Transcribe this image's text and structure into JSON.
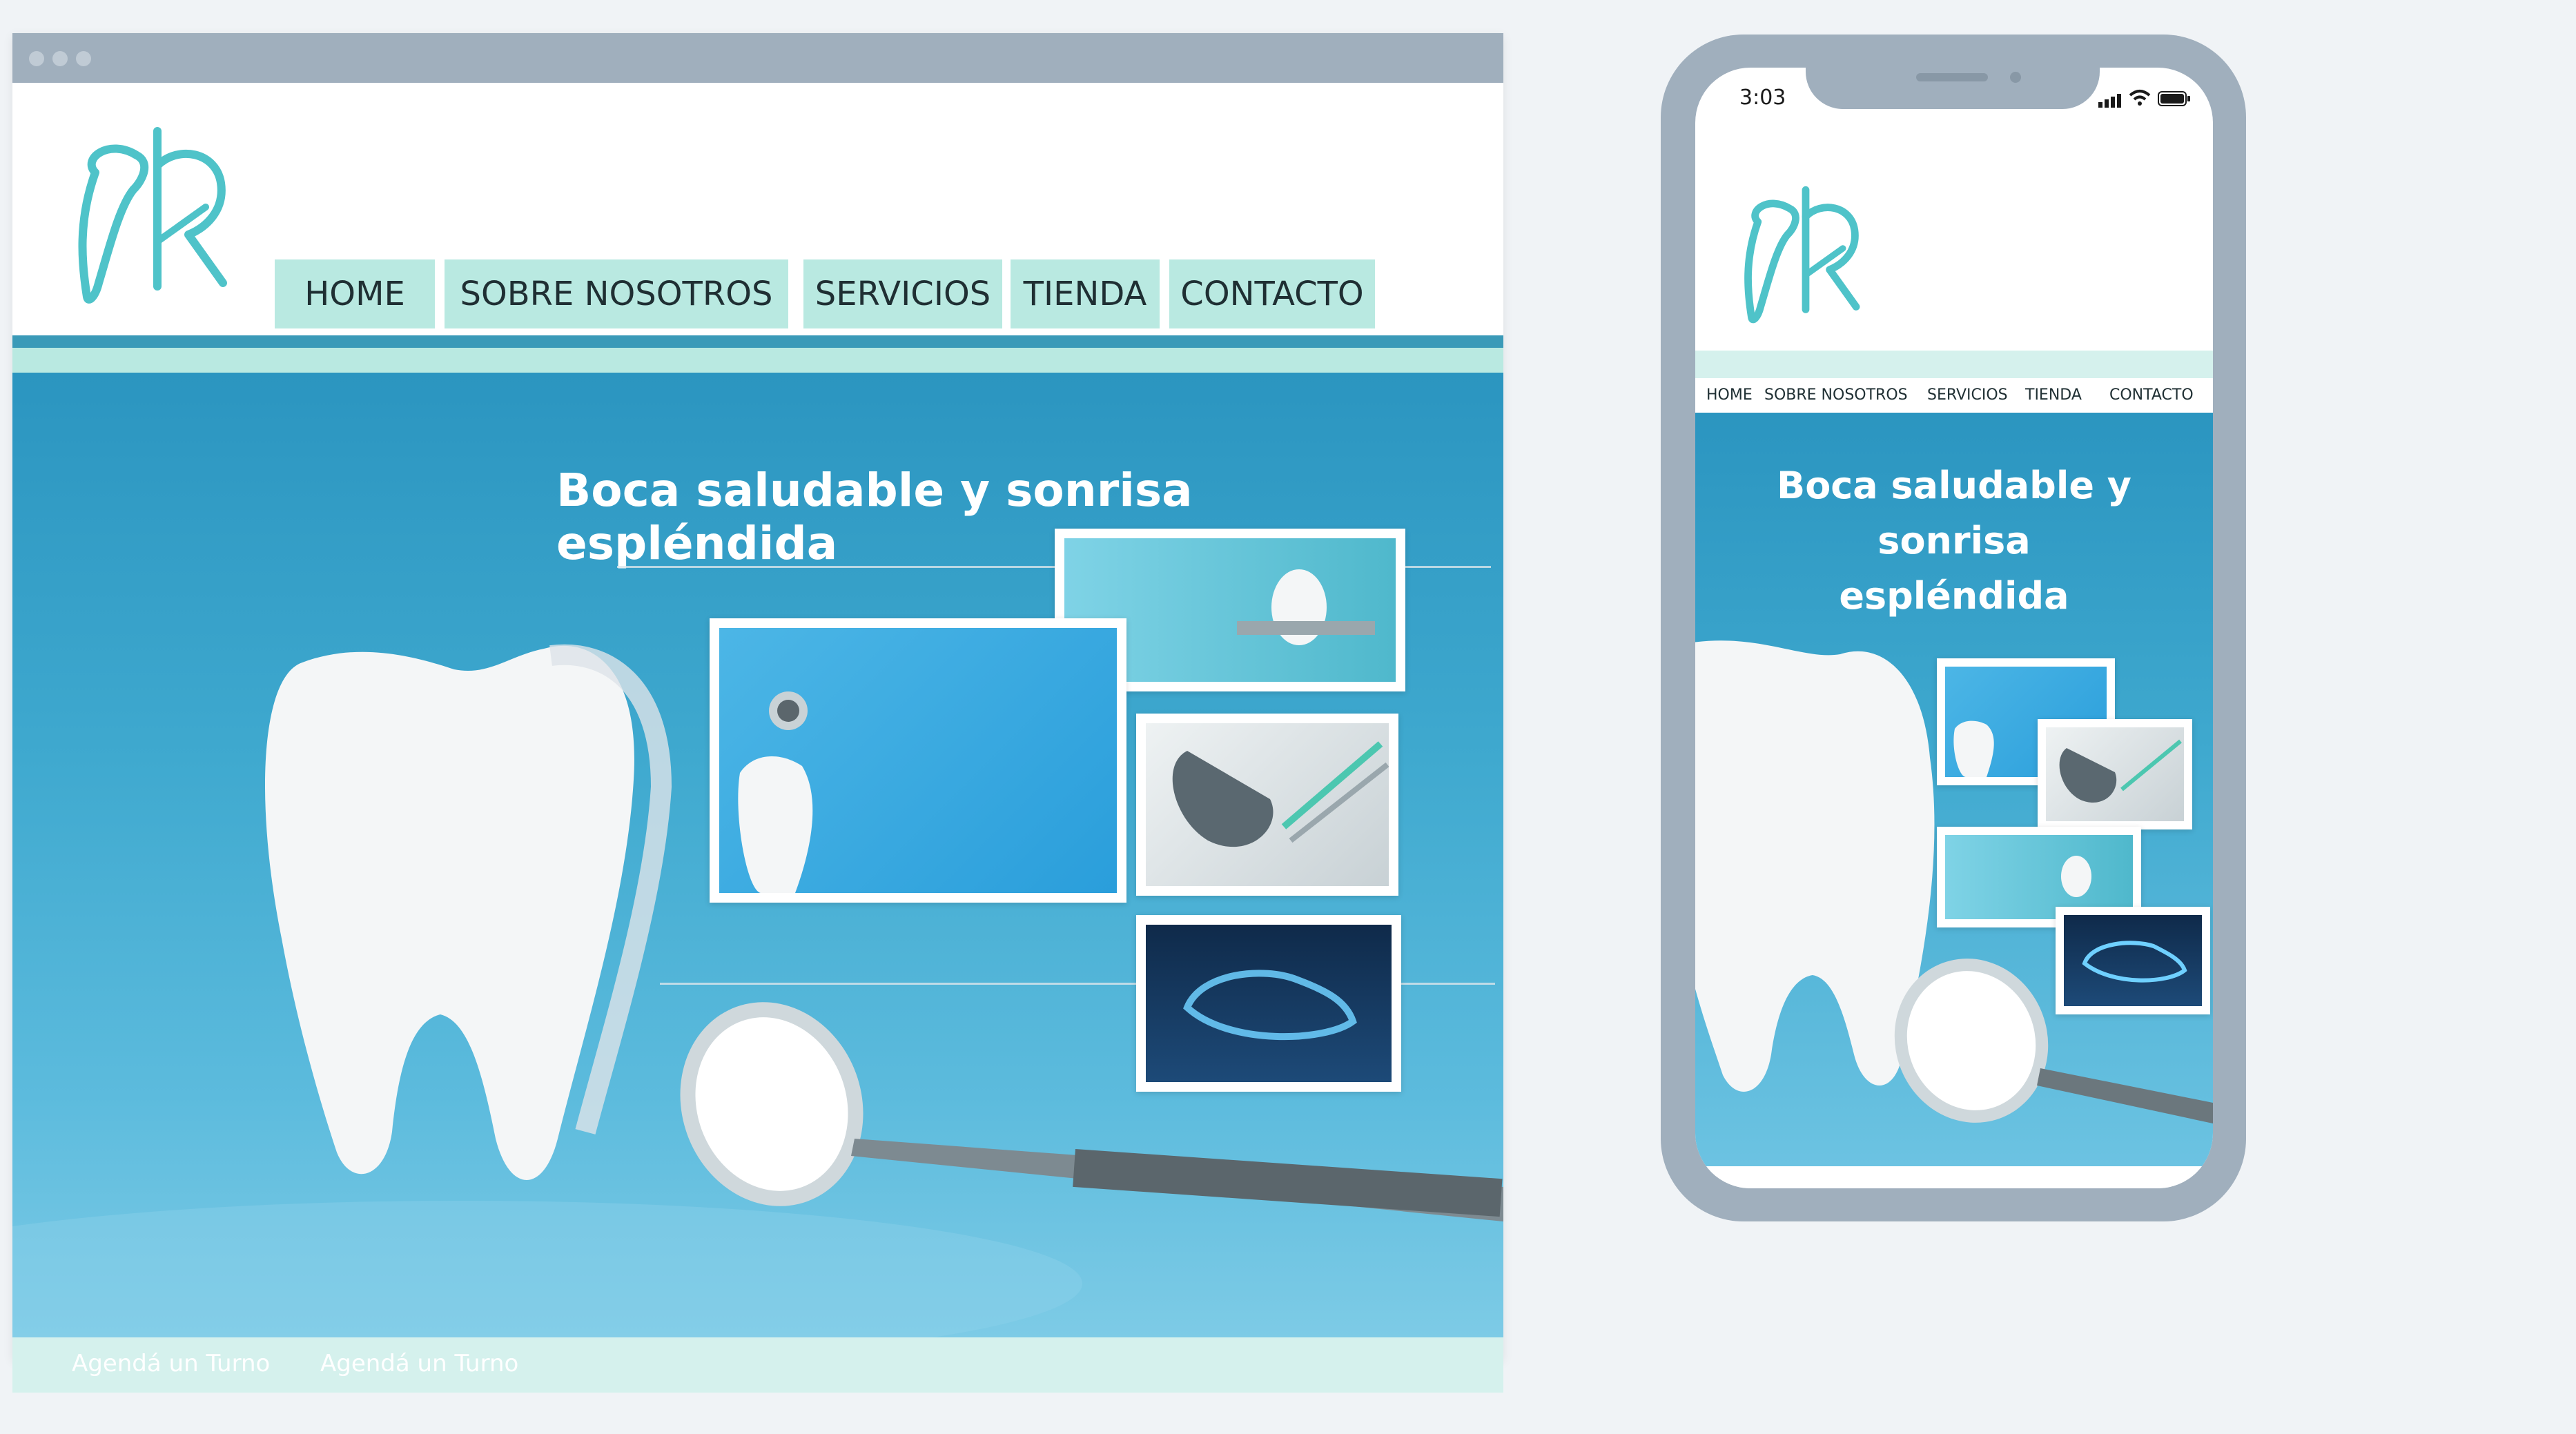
{
  "desktop": {
    "nav": [
      "HOME",
      "SOBRE NOSOTROS",
      "SERVICIOS",
      "TIENDA",
      "CONTACTO"
    ],
    "hero_title": "Boca saludable y sonrisa espléndida",
    "footer_links": [
      "Agendá un Turno",
      "Agendá un Turno"
    ]
  },
  "mobile": {
    "status_time": "3:03",
    "nav": [
      "HOME",
      "SOBRE NOSOTROS",
      "SERVICIOS",
      "TIENDA",
      "CONTACTO"
    ],
    "hero_title_line1": "Boca saludable y sonrisa",
    "hero_title_line2": "espléndida"
  },
  "colors": {
    "browser_chrome": "#a0afbd",
    "nav_bg": "#b9e9e1",
    "accent_dark": "#3a9ab8",
    "logo_teal": "#4fc3c9",
    "hero_blue": "#3fa9cf"
  },
  "icons": [
    "window-dots-icon",
    "logo-tooth-icon",
    "signal-icon",
    "wifi-icon",
    "battery-icon"
  ]
}
